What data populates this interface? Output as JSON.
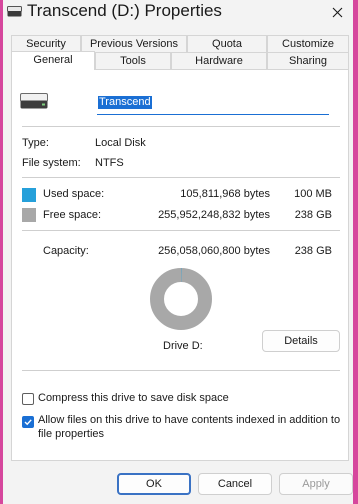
{
  "window": {
    "title": "Transcend (D:) Properties",
    "title_icon": "drive-icon",
    "close_icon": "close-icon"
  },
  "tabs": {
    "row1": [
      "Security",
      "Previous Versions",
      "Quota",
      "Customize"
    ],
    "row2": [
      "General",
      "Tools",
      "Hardware",
      "Sharing"
    ],
    "active": "General"
  },
  "general": {
    "drive_name": "Transcend",
    "type_label": "Type:",
    "type_value": "Local Disk",
    "fs_label": "File system:",
    "fs_value": "NTFS",
    "used_label": "Used space:",
    "used_bytes": "105,811,968 bytes",
    "used_size": "100 MB",
    "free_label": "Free space:",
    "free_bytes": "255,952,248,832 bytes",
    "free_size": "238 GB",
    "capacity_label": "Capacity:",
    "capacity_bytes": "256,058,060,800 bytes",
    "capacity_size": "238 GB",
    "drive_label": "Drive D:",
    "details_button": "Details",
    "used_fraction": 0.0004,
    "compress_label": "Compress this drive to save disk space",
    "compress_checked": false,
    "index_label_line1": "Allow files on this drive to have contents indexed in addition to",
    "index_label_line2": "file properties",
    "index_checked": true
  },
  "buttons": {
    "ok": "OK",
    "cancel": "Cancel",
    "apply": "Apply"
  },
  "colors": {
    "used": "#26a0da",
    "free": "#a8a8a8",
    "accent": "#1a6fd4",
    "frame": "#d6479d"
  }
}
